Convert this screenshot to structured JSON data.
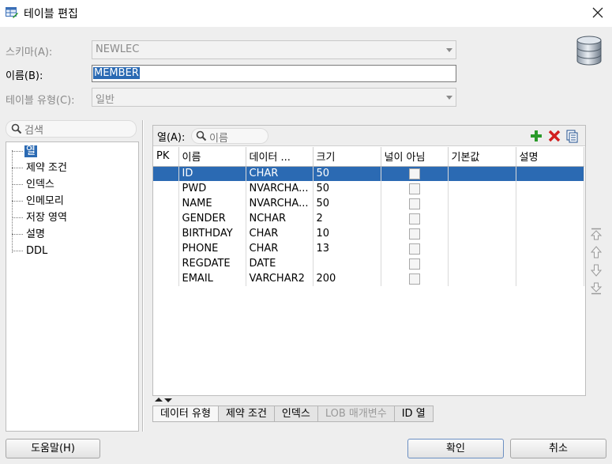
{
  "window": {
    "title": "테이블 편집",
    "icon": "table-edit-icon",
    "close_icon": "close-icon"
  },
  "form": {
    "schema_label": "스키마(A):",
    "schema_value": "NEWLEC",
    "name_label": "이름(B):",
    "name_value": "MEMBER",
    "table_type_label": "테이블 유형(C):",
    "table_type_value": "일반"
  },
  "left_search": {
    "placeholder": "검색",
    "icon": "search-icon"
  },
  "tree": {
    "items": [
      {
        "label": "열",
        "selected": true
      },
      {
        "label": "제약 조건"
      },
      {
        "label": "인덱스"
      },
      {
        "label": "인메모리"
      },
      {
        "label": "저장 영역"
      },
      {
        "label": "설명"
      },
      {
        "label": "DDL"
      }
    ]
  },
  "columns_panel": {
    "label": "열(A):",
    "search_placeholder": "이름",
    "headers": [
      "PK",
      "이름",
      "데이터 ...",
      "크기",
      "널이 아님",
      "기본값",
      "설명"
    ],
    "rows": [
      {
        "pk": "",
        "name": "ID",
        "type": "CHAR",
        "size": "50",
        "not_null": false,
        "default": "",
        "desc": ""
      },
      {
        "pk": "",
        "name": "PWD",
        "type": "NVARCHA...",
        "size": "50",
        "not_null": false,
        "default": "",
        "desc": ""
      },
      {
        "pk": "",
        "name": "NAME",
        "type": "NVARCHA...",
        "size": "50",
        "not_null": false,
        "default": "",
        "desc": ""
      },
      {
        "pk": "",
        "name": "GENDER",
        "type": "NCHAR",
        "size": "2",
        "not_null": false,
        "default": "",
        "desc": ""
      },
      {
        "pk": "",
        "name": "BIRTHDAY",
        "type": "CHAR",
        "size": "10",
        "not_null": false,
        "default": "",
        "desc": ""
      },
      {
        "pk": "",
        "name": "PHONE",
        "type": "CHAR",
        "size": "13",
        "not_null": false,
        "default": "",
        "desc": ""
      },
      {
        "pk": "",
        "name": "REGDATE",
        "type": "DATE",
        "size": "",
        "not_null": false,
        "default": "",
        "desc": ""
      },
      {
        "pk": "",
        "name": "EMAIL",
        "type": "VARCHAR2",
        "size": "200",
        "not_null": false,
        "default": "",
        "desc": ""
      }
    ],
    "toolbar_icons": [
      "add-column-icon",
      "delete-column-icon",
      "copy-column-icon"
    ],
    "move_icons": [
      "move-top-icon",
      "move-up-icon",
      "move-down-icon",
      "move-bottom-icon"
    ]
  },
  "tabs": [
    {
      "label": "데이터 유형",
      "enabled": true
    },
    {
      "label": "제약 조건",
      "enabled": true
    },
    {
      "label": "인덱스",
      "enabled": true
    },
    {
      "label": "LOB 매개변수",
      "enabled": false
    },
    {
      "label": "ID 열",
      "enabled": true
    }
  ],
  "buttons": {
    "help": "도움말(H)",
    "ok": "확인",
    "cancel": "취소"
  },
  "colors": {
    "selection": "#2b6ab3",
    "add": "#2a9a2a",
    "delete": "#d21e1e"
  }
}
